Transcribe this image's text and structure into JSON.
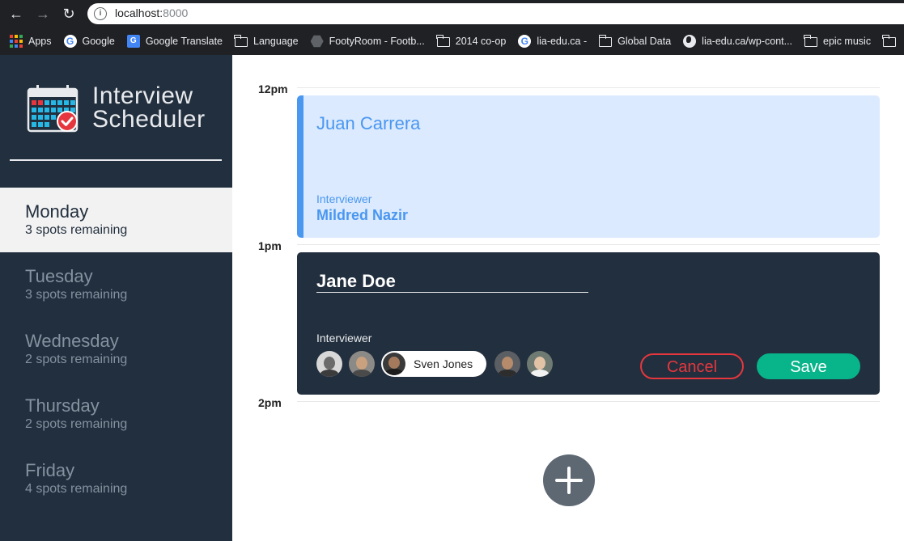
{
  "browser": {
    "url_host": "localhost:",
    "url_port": "8000",
    "bookmarks": [
      {
        "label": "Apps",
        "icon": "apps-grid-icon"
      },
      {
        "label": "Google",
        "icon": "google-icon"
      },
      {
        "label": "Google Translate",
        "icon": "google-translate-icon"
      },
      {
        "label": "Language",
        "icon": "folder-icon"
      },
      {
        "label": "FootyRoom - Footb...",
        "icon": "footyroom-icon"
      },
      {
        "label": "2014 co-op",
        "icon": "folder-icon"
      },
      {
        "label": "lia-edu.ca -",
        "icon": "google-icon"
      },
      {
        "label": "Global Data",
        "icon": "folder-icon"
      },
      {
        "label": "lia-edu.ca/wp-cont...",
        "icon": "globe-icon"
      },
      {
        "label": "epic music",
        "icon": "folder-icon"
      }
    ]
  },
  "sidebar": {
    "title_line1": "Interview",
    "title_line2": "Scheduler",
    "days": [
      {
        "name": "Monday",
        "spots": "3 spots remaining",
        "selected": true
      },
      {
        "name": "Tuesday",
        "spots": "3 spots remaining",
        "selected": false
      },
      {
        "name": "Wednesday",
        "spots": "2 spots remaining",
        "selected": false
      },
      {
        "name": "Thursday",
        "spots": "2 spots remaining",
        "selected": false
      },
      {
        "name": "Friday",
        "spots": "4 spots remaining",
        "selected": false
      }
    ]
  },
  "schedule": {
    "times": [
      "12pm",
      "1pm",
      "2pm"
    ],
    "appointment": {
      "student": "Juan Carrera",
      "interviewer_label": "Interviewer",
      "interviewer": "Mildred Nazir"
    },
    "form": {
      "student_value": "Jane Doe",
      "interviewer_label": "Interviewer",
      "selected_interviewer": "Sven Jones",
      "cancel_label": "Cancel",
      "save_label": "Save"
    }
  },
  "colors": {
    "sidebar_bg": "#222f3e",
    "appointment_accent": "#4a97f0",
    "save": "#08b48a",
    "cancel": "#e5373d"
  }
}
